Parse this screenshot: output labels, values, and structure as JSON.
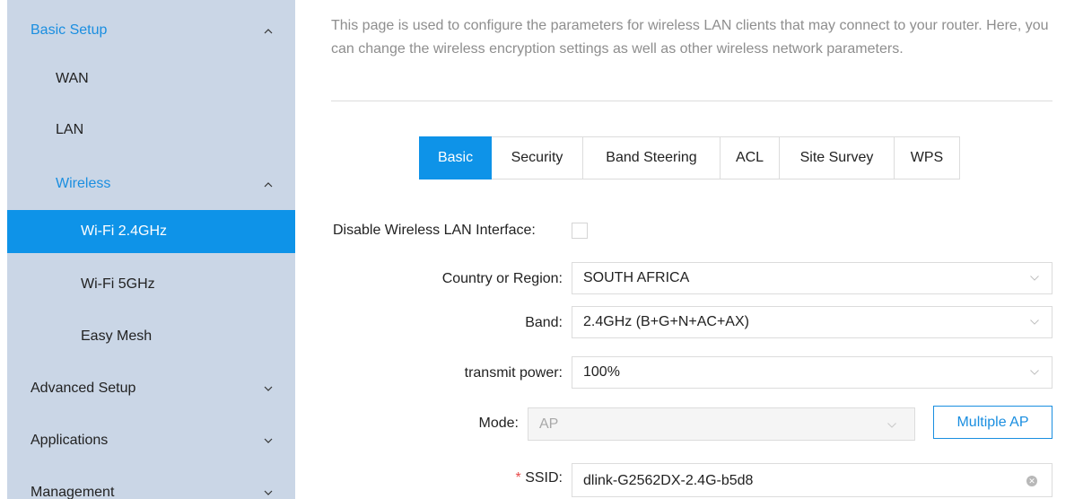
{
  "sidebar": {
    "basic_setup": "Basic Setup",
    "wan": "WAN",
    "lan": "LAN",
    "wireless": "Wireless",
    "wifi24": "Wi-Fi 2.4GHz",
    "wifi5": "Wi-Fi 5GHz",
    "easy_mesh": "Easy Mesh",
    "advanced_setup": "Advanced Setup",
    "applications": "Applications",
    "management": "Management"
  },
  "intro": "This page is used to configure the parameters for wireless LAN clients that may connect to your router. Here, you can change the wireless encryption settings as well as other wireless network parameters.",
  "tabs": [
    "Basic",
    "Security",
    "Band Steering",
    "ACL",
    "Site Survey",
    "WPS"
  ],
  "form": {
    "disable_label": "Disable Wireless LAN Interface:",
    "country_label": "Country or Region:",
    "country_value": "SOUTH AFRICA",
    "band_label": "Band:",
    "band_value": "2.4GHz (B+G+N+AC+AX)",
    "power_label": "transmit power:",
    "power_value": "100%",
    "mode_label": "Mode:",
    "mode_value": "AP",
    "multiple_ap": "Multiple AP",
    "ssid_required": "*",
    "ssid_label": "SSID:",
    "ssid_value": "dlink-G2562DX-2.4G-b5d8"
  },
  "colors": {
    "accent": "#0e93e8",
    "sidebar_bg": "#cad6e6",
    "link_blue": "#1a8ee0"
  }
}
